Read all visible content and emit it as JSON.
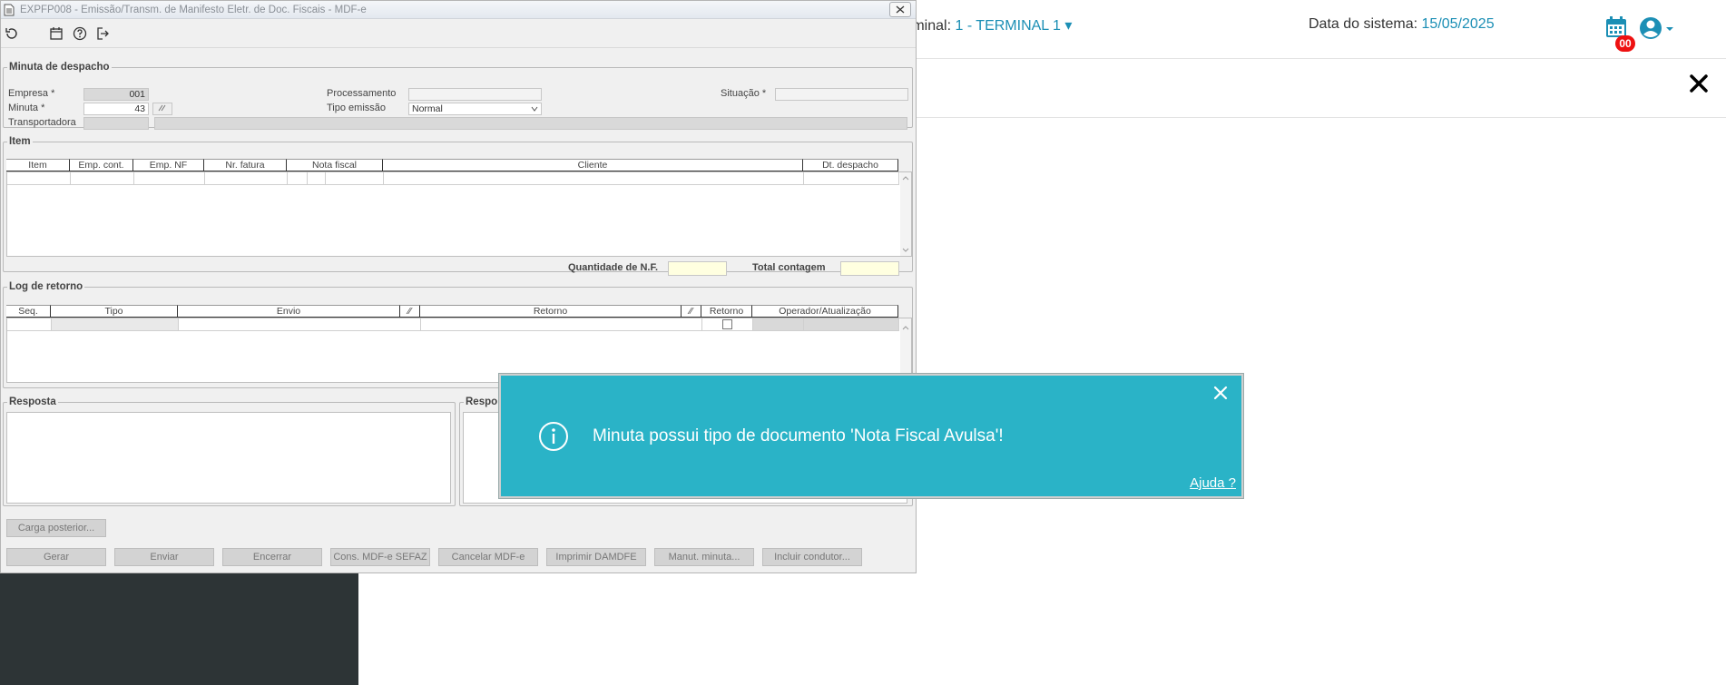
{
  "background": {
    "terminal_label": "rminal:",
    "terminal_value": "1 - TERMINAL 1",
    "date_label": "Data do sistema:",
    "date_value": "15/05/2025",
    "badge_count": "00",
    "accent_color": "#1c8fb5"
  },
  "window": {
    "title": "EXPFP008 - Emissão/Transm. de Manifesto Eletr. de Doc. Fiscais - MDF-e",
    "toolbar_icons": [
      "refresh-icon",
      "calendar-icon",
      "help-icon",
      "exit-icon"
    ]
  },
  "minuta": {
    "legend": "Minuta de despacho",
    "empresa_label": "Empresa *",
    "empresa_value": "001",
    "minuta_label": "Minuta *",
    "minuta_value": "43",
    "transportadora_label": "Transportadora",
    "processamento_label": "Processamento",
    "tipo_emissao_label": "Tipo emissão",
    "tipo_emissao_value": "Normal",
    "situacao_label": "Situação *"
  },
  "item": {
    "legend": "Item",
    "columns": [
      "Item",
      "Emp. cont.",
      "Emp. NF",
      "Nr. fatura",
      "Nota fiscal",
      "Cliente",
      "Dt. despacho"
    ],
    "qtd_label": "Quantidade de N.F.",
    "total_label": "Total contagem"
  },
  "log": {
    "legend": "Log de retorno",
    "columns": [
      "Seq.",
      "Tipo",
      "Envio",
      "Retorno",
      "Retorno",
      "Operador/Atualização"
    ]
  },
  "resposta": {
    "legend1": "Resposta",
    "legend2": "Respo"
  },
  "buttons": {
    "carga": "Carga posterior...",
    "gerar": "Gerar",
    "enviar": "Enviar",
    "encerrar": "Encerrar",
    "cons": "Cons. MDF-e SEFAZ",
    "cancelar": "Cancelar MDF-e",
    "imprimir": "Imprimir DAMDFE",
    "manut": "Manut. minuta...",
    "incluir": "Incluir condutor..."
  },
  "toast": {
    "message": "Minuta possui tipo de documento 'Nota Fiscal Avulsa'!",
    "help": "Ajuda ?",
    "color": "#2ab3c7"
  }
}
